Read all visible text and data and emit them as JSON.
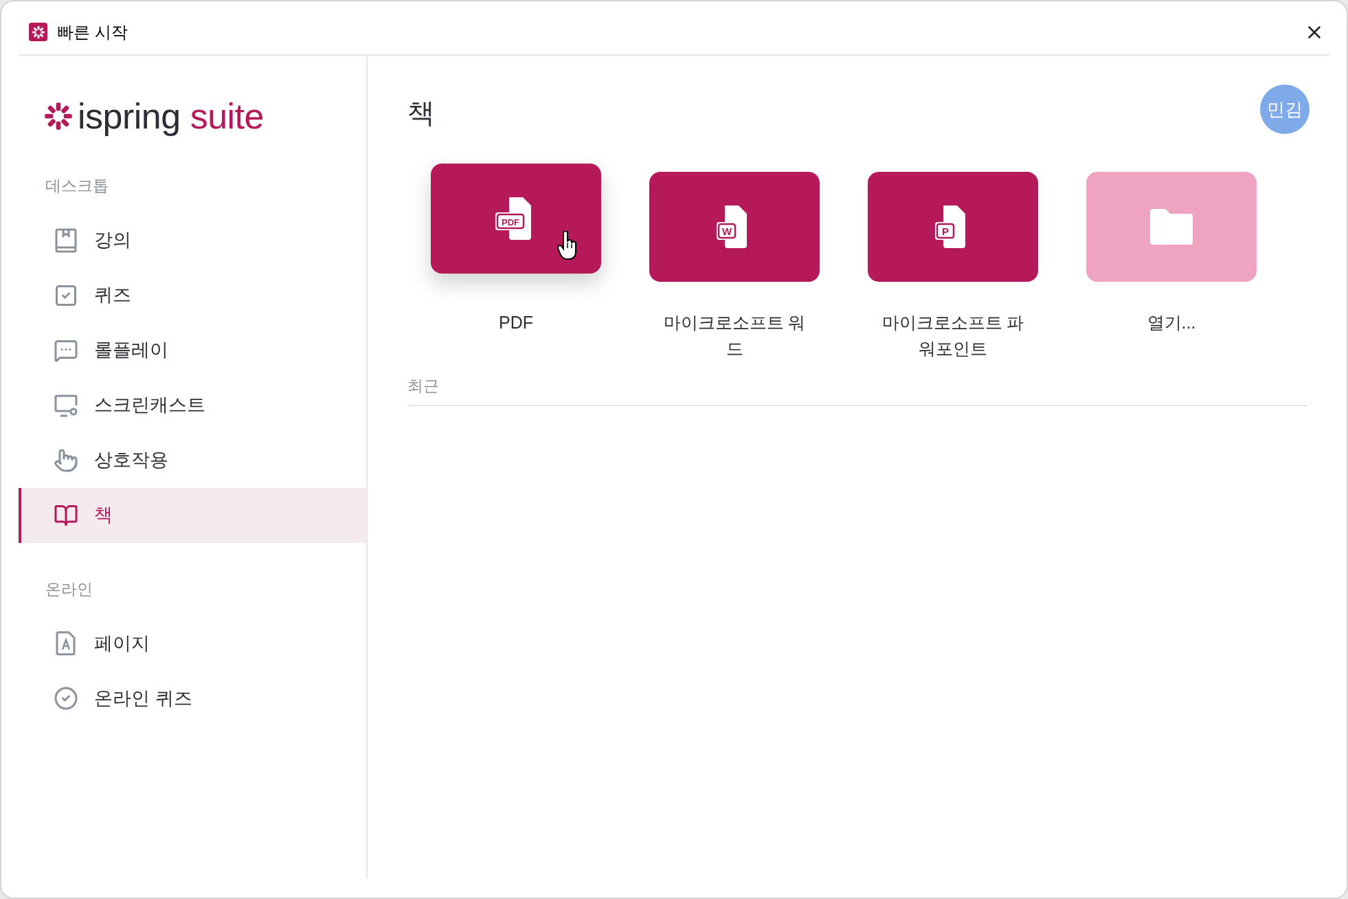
{
  "window": {
    "title": "빠른 시작"
  },
  "logo": {
    "brand": "ispring",
    "product": "suite"
  },
  "sidebar": {
    "sections": [
      {
        "heading": "데스크톱",
        "items": [
          {
            "label": "강의",
            "selected": false
          },
          {
            "label": "퀴즈",
            "selected": false
          },
          {
            "label": "롤플레이",
            "selected": false
          },
          {
            "label": "스크린캐스트",
            "selected": false
          },
          {
            "label": "상호작용",
            "selected": false
          },
          {
            "label": "책",
            "selected": true
          }
        ]
      },
      {
        "heading": "온라인",
        "items": [
          {
            "label": "페이지",
            "selected": false
          },
          {
            "label": "온라인 퀴즈",
            "selected": false
          }
        ]
      }
    ]
  },
  "main": {
    "title": "책",
    "avatar": "민김",
    "tiles": [
      {
        "kind": "pdf",
        "badge": "PDF",
        "label": "PDF",
        "hovered": true
      },
      {
        "kind": "word",
        "badge": "W",
        "label": "마이크로소프트 워드",
        "hovered": false
      },
      {
        "kind": "powerpoint",
        "badge": "P",
        "label": "마이크로소프트 파워포인트",
        "hovered": false
      },
      {
        "kind": "open",
        "label": "열기...",
        "hovered": false
      }
    ],
    "recent_heading": "최근"
  }
}
